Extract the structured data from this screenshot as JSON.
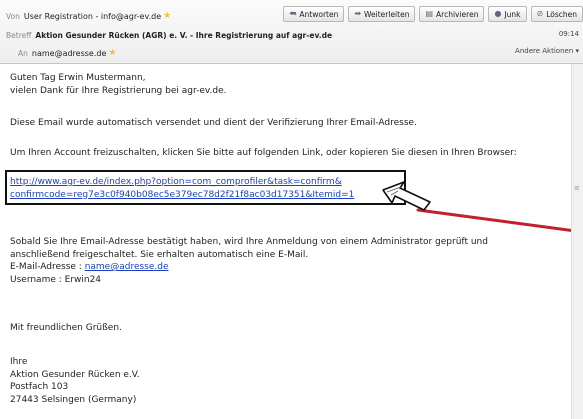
{
  "header": {
    "from_label": "Von",
    "from_value": "User Registration - info@agr-ev.de",
    "subject_label": "Betreff",
    "subject_value": "Aktion Gesunder Rücken (AGR) e. V. - Ihre Registrierung auf agr-ev.de",
    "to_label": "An",
    "to_value": "name@adresse.de",
    "time": "09:14",
    "more_actions": "Andere Aktionen ▾",
    "star_icon": "star-icon"
  },
  "toolbar": {
    "reply": "Antworten",
    "forward": "Weiterleiten",
    "archive": "Archivieren",
    "junk": "Junk",
    "delete": "Löschen"
  },
  "body": {
    "greeting": "Guten Tag Erwin Mustermann,",
    "thanks": "vielen Dank für Ihre Registrierung bei agr-ev.de.",
    "auto_info": "Diese Email wurde automatisch versendet und dient der Verifizierung Ihrer Email-Adresse.",
    "instruction": "Um Ihren Account freizuschalten, klicken Sie bitte auf folgenden Link, oder kopieren Sie diesen in Ihren Browser:",
    "link_line1": "http://www.agr-ev.de/index.php?option=com_comprofiler&task=confirm&",
    "link_line2": "confirmcode=reg7e3c0f940b08ec5e379ec78d2f21f8ac03d17351&Itemid=1",
    "approval_line1": "Sobald Sie Ihre Email-Adresse bestätigt haben, wird Ihre Anmeldung von einem Administrator geprüft und",
    "approval_line2": "anschließend freigeschaltet. Sie erhalten automatisch eine E-Mail.",
    "email_label": "E-Mail-Adresse : ",
    "email_value": "name@adresse.de",
    "username_line": "Username : Erwin24",
    "closing": "Mit freundlichen Grüßen.",
    "sig_1": "Ihre",
    "sig_2": "Aktion Gesunder Rücken e.V.",
    "sig_3": "Postfach 103",
    "sig_4": "27443 Selsingen (Germany)"
  },
  "colors": {
    "link": "#1a3fc4",
    "highlight_box": "#111111",
    "annotation_line": "#c0212b"
  }
}
